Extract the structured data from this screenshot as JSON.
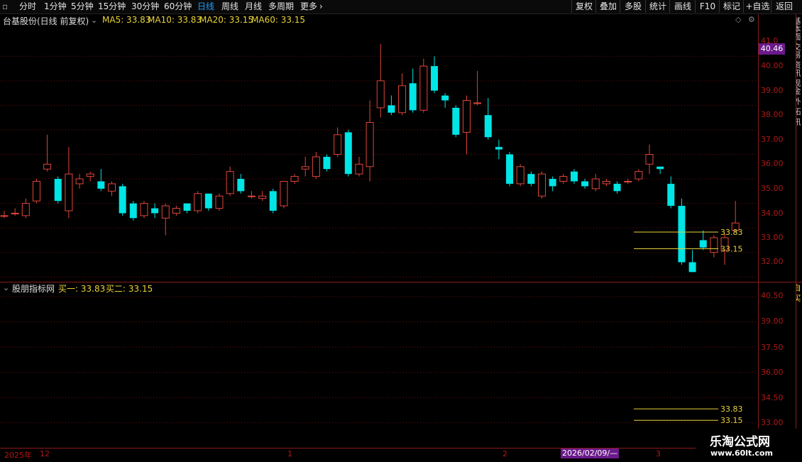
{
  "toolbar": {
    "left_items": [
      "分时",
      "1分钟",
      "5分钟",
      "15分钟",
      "30分钟",
      "60分钟",
      "日线",
      "周线",
      "月线",
      "多周期",
      "更多"
    ],
    "active": "日线",
    "more_arrow": "chevron-right-icon",
    "right_items": [
      "复权",
      "叠加",
      "多股",
      "统计",
      "画线",
      "F10",
      "标记",
      "+自选",
      "返回"
    ]
  },
  "main_panel": {
    "stock_title": "台基股份(日线 前复权)",
    "ma_labels": [
      {
        "label": "MA5: 33.83",
        "color": "#e8d23a"
      },
      {
        "label": "MA10: 33.83",
        "color": "#e8d23a"
      },
      {
        "label": "MA20: 33.15",
        "color": "#e8d23a"
      },
      {
        "label": "MA60: 33.15",
        "color": "#e8d23a"
      }
    ],
    "price_tag": "40.46",
    "y_ticks": [
      "41.0",
      "40.00",
      "39.00",
      "38.00",
      "37.00",
      "36.00",
      "35.00",
      "34.00",
      "33.00",
      "32.00"
    ],
    "level_labels": [
      "33.83",
      "33.15"
    ],
    "right_strip": "基本面 交易 资讯 现金 外 拓 讯"
  },
  "sub_panel": {
    "indicator_name": "股朋指标网",
    "buy1": "买一: 33.83",
    "buy2": "买二: 33.15",
    "y_ticks": [
      "40.50",
      "39.00",
      "37.50",
      "36.00",
      "34.50",
      "33.00"
    ],
    "level_labels": [
      "33.83",
      "33.15"
    ],
    "right_strip": "自 买"
  },
  "date_axis": {
    "labels": [
      "2025年",
      "12",
      "1",
      "2",
      "3"
    ],
    "selected_date": "2026/02/09/—"
  },
  "watermark": {
    "line1": "乐淘公式网",
    "line2": "www.60lt.com"
  },
  "colors": {
    "up": "#e0453a",
    "down": "#00e5e5",
    "level": "#e8d23a",
    "grid": "#6b1010",
    "accent": "#20a0ff"
  },
  "chart_data": {
    "type": "candlestick",
    "ylim": [
      31.6,
      41.4
    ],
    "levels": [
      33.83,
      33.15
    ],
    "candles": [
      [
        34.5,
        34.5,
        34.7,
        34.4
      ],
      [
        34.6,
        34.6,
        34.8,
        34.5
      ],
      [
        34.5,
        35.0,
        35.2,
        34.4
      ],
      [
        35.1,
        35.9,
        36.0,
        35.0
      ],
      [
        36.4,
        36.6,
        37.8,
        36.3
      ],
      [
        36.0,
        35.1,
        36.1,
        35.0
      ],
      [
        34.7,
        36.2,
        37.3,
        34.4
      ],
      [
        35.8,
        36.0,
        36.2,
        35.6
      ],
      [
        36.1,
        36.2,
        36.3,
        35.9
      ],
      [
        35.9,
        35.6,
        36.4,
        35.5
      ],
      [
        35.5,
        35.8,
        35.9,
        35.3
      ],
      [
        35.7,
        34.6,
        35.8,
        34.5
      ],
      [
        35.0,
        34.4,
        35.1,
        34.3
      ],
      [
        34.5,
        35.0,
        35.1,
        34.4
      ],
      [
        34.8,
        34.6,
        35.0,
        34.4
      ],
      [
        34.4,
        34.9,
        35.0,
        33.7
      ],
      [
        34.6,
        34.8,
        34.9,
        34.5
      ],
      [
        35.0,
        34.7,
        35.0,
        34.6
      ],
      [
        34.7,
        35.4,
        35.5,
        34.6
      ],
      [
        35.4,
        34.8,
        35.4,
        34.7
      ],
      [
        34.8,
        35.3,
        35.4,
        34.7
      ],
      [
        35.4,
        36.3,
        36.5,
        35.3
      ],
      [
        36.0,
        35.5,
        36.2,
        35.4
      ],
      [
        35.3,
        35.3,
        35.5,
        35.2
      ],
      [
        35.2,
        35.3,
        35.5,
        35.1
      ],
      [
        35.5,
        34.7,
        35.6,
        34.6
      ],
      [
        34.9,
        35.9,
        35.9,
        34.8
      ],
      [
        35.9,
        36.1,
        36.2,
        35.8
      ],
      [
        36.4,
        36.5,
        36.9,
        36.1
      ],
      [
        36.1,
        36.9,
        37.1,
        36.0
      ],
      [
        36.9,
        36.4,
        37.0,
        36.3
      ],
      [
        37.0,
        37.8,
        38.1,
        36.9
      ],
      [
        37.9,
        36.2,
        38.0,
        36.1
      ],
      [
        36.2,
        36.6,
        36.9,
        36.1
      ],
      [
        36.5,
        38.3,
        39.2,
        35.9
      ],
      [
        38.9,
        40.0,
        41.5,
        38.5
      ],
      [
        39.0,
        38.7,
        39.4,
        38.6
      ],
      [
        38.7,
        39.8,
        40.3,
        38.6
      ],
      [
        39.9,
        38.8,
        40.5,
        38.7
      ],
      [
        38.8,
        40.6,
        40.9,
        38.7
      ],
      [
        40.6,
        39.6,
        41.0,
        39.5
      ],
      [
        39.4,
        39.2,
        39.5,
        38.9
      ],
      [
        38.9,
        37.8,
        39.0,
        37.7
      ],
      [
        37.9,
        39.2,
        39.4,
        37.0
      ],
      [
        39.1,
        39.1,
        40.4,
        39.0
      ],
      [
        38.6,
        37.7,
        39.3,
        37.6
      ],
      [
        37.3,
        37.2,
        37.6,
        36.8
      ],
      [
        37.0,
        35.8,
        37.1,
        35.7
      ],
      [
        35.8,
        36.5,
        36.6,
        35.7
      ],
      [
        36.2,
        35.8,
        36.3,
        35.7
      ],
      [
        35.3,
        36.2,
        36.3,
        35.2
      ],
      [
        36.0,
        35.7,
        36.1,
        35.5
      ],
      [
        35.9,
        36.1,
        36.2,
        35.8
      ],
      [
        36.3,
        35.9,
        36.4,
        35.8
      ],
      [
        35.9,
        35.7,
        36.0,
        35.6
      ],
      [
        35.6,
        36.0,
        36.2,
        35.5
      ],
      [
        35.8,
        35.9,
        36.0,
        35.7
      ],
      [
        35.8,
        35.5,
        35.9,
        35.4
      ],
      [
        35.9,
        35.9,
        36.0,
        35.8
      ],
      [
        36.0,
        36.3,
        36.4,
        35.9
      ],
      [
        36.6,
        37.0,
        37.4,
        36.2
      ],
      [
        36.5,
        36.4,
        36.5,
        36.2
      ],
      [
        35.8,
        34.9,
        36.1,
        34.8
      ],
      [
        34.9,
        32.6,
        35.2,
        32.5
      ],
      [
        32.6,
        32.2,
        33.1,
        32.2
      ],
      [
        33.5,
        33.2,
        33.9,
        33.1
      ],
      [
        33.0,
        33.6,
        33.7,
        32.8
      ],
      [
        33.1,
        33.6,
        33.8,
        32.5
      ],
      [
        33.9,
        34.2,
        35.1,
        33.8
      ]
    ]
  }
}
